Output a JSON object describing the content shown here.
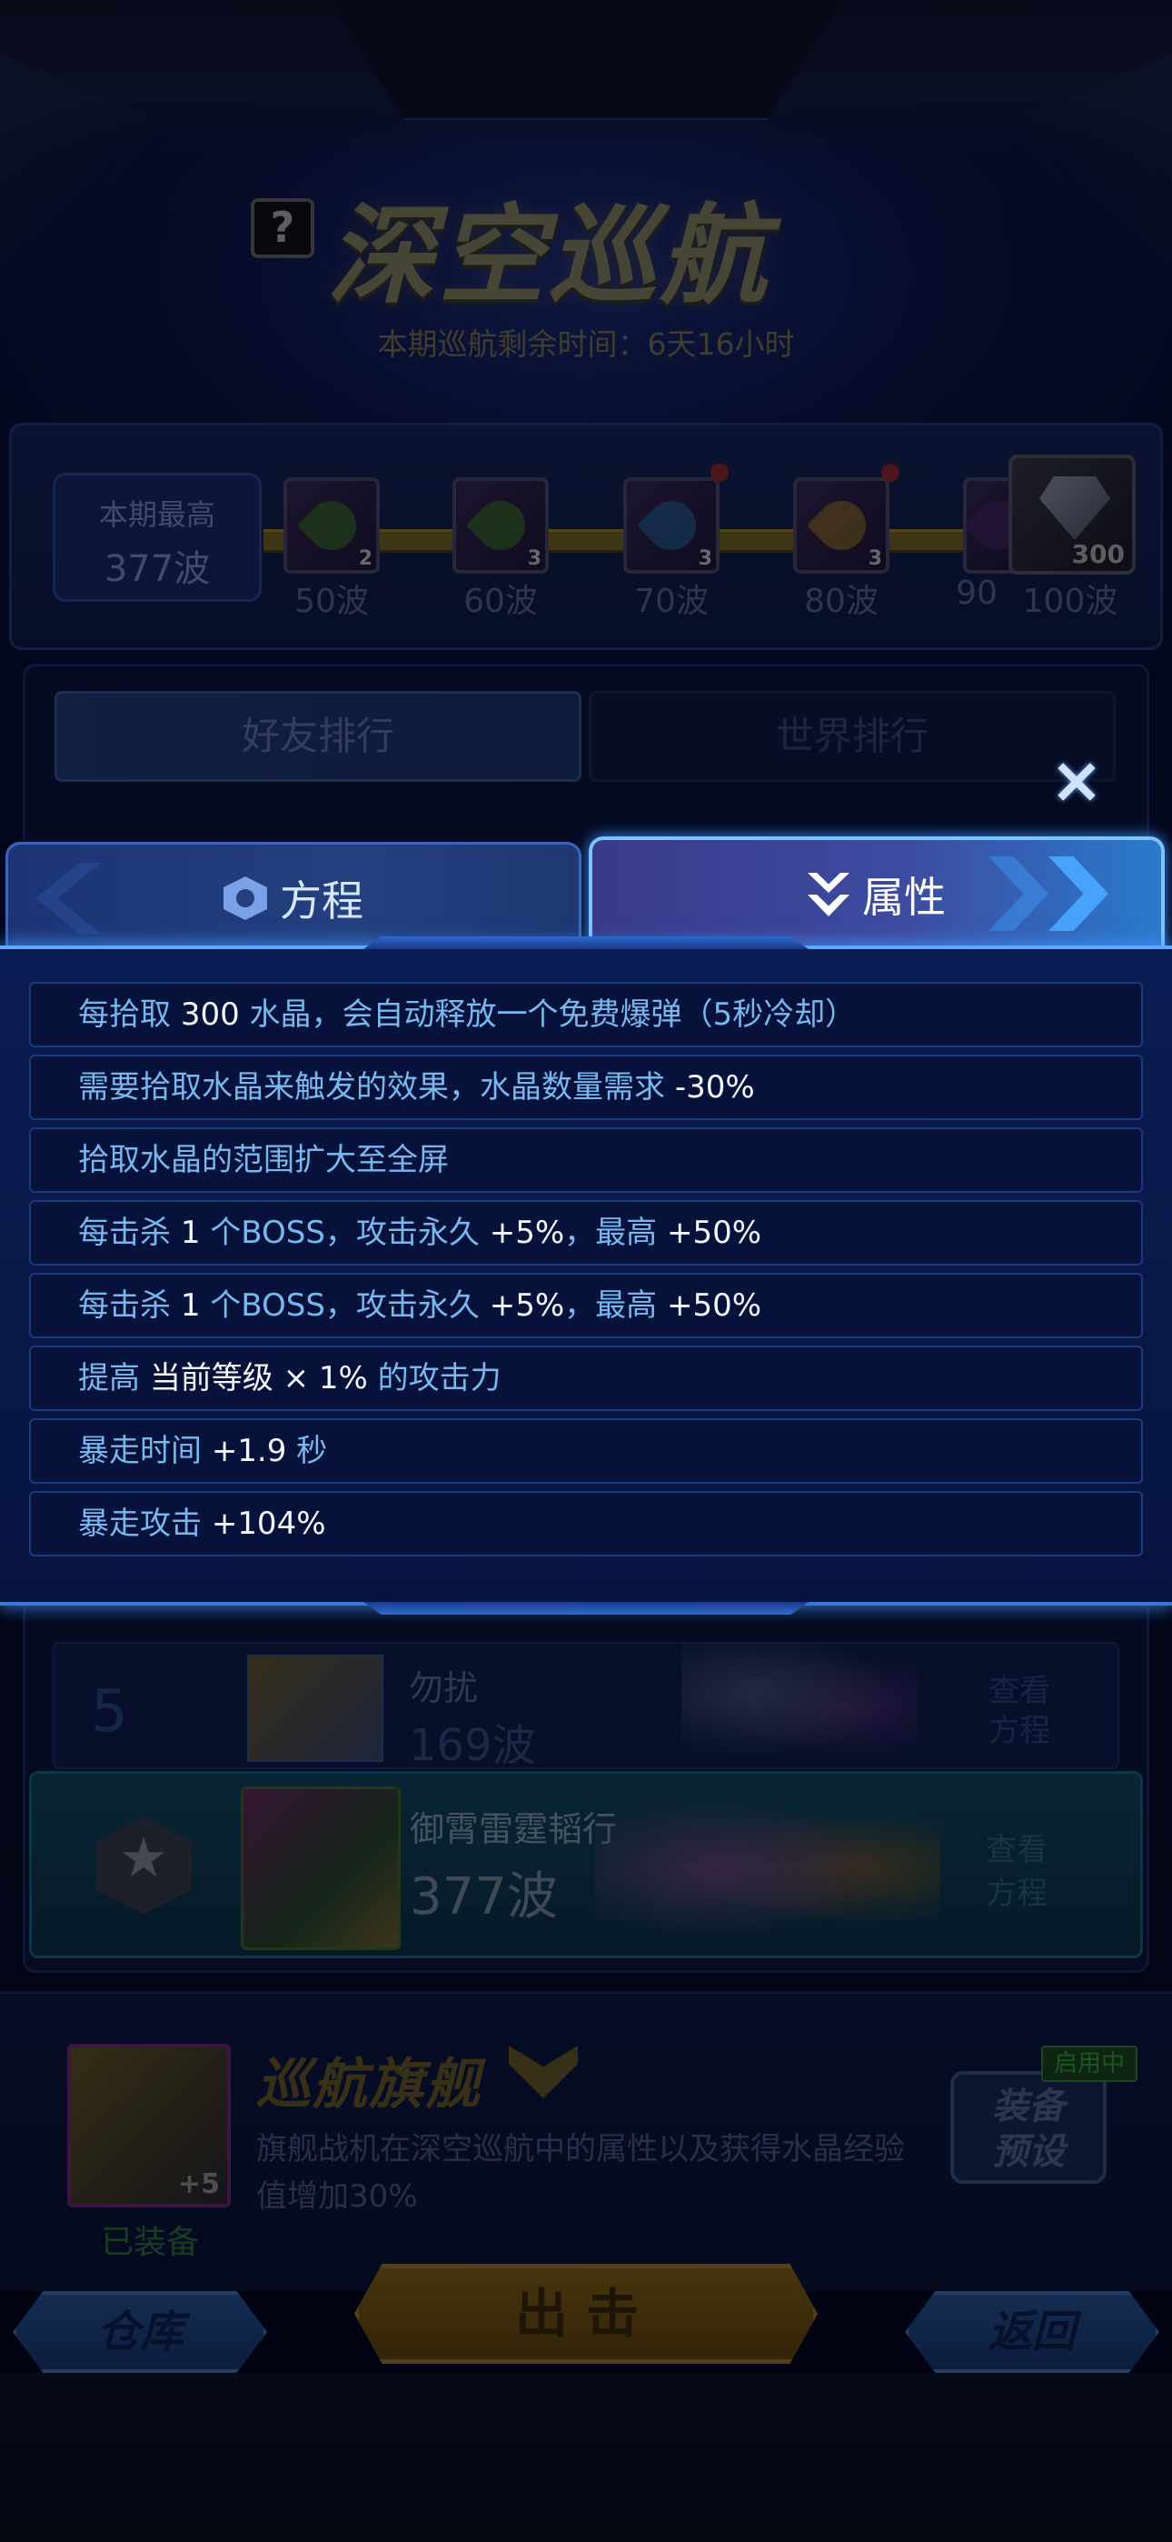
{
  "header": {
    "title": "深空巡航",
    "subtitle": "本期巡航剩余时间：6天16小时",
    "help_icon": "?"
  },
  "wave_progress": {
    "best_label": "本期最高",
    "best_value": "377波",
    "rewards": [
      {
        "label": "50波",
        "count": "2",
        "icon": "green-key-icon"
      },
      {
        "label": "60波",
        "count": "3",
        "icon": "green-key-icon"
      },
      {
        "label": "70波",
        "count": "3",
        "icon": "blue-key-icon"
      },
      {
        "label": "80波",
        "count": "3",
        "icon": "gold-key-icon"
      },
      {
        "label": "90",
        "count": "",
        "icon": "key-icon"
      },
      {
        "label": "100波",
        "count": "300",
        "icon": "diamond-icon"
      }
    ]
  },
  "leaderboard": {
    "tab_friends": "好友排行",
    "tab_world": "世界排行",
    "rows": [
      {
        "rank": "5",
        "name": "勿扰",
        "wave": "169波",
        "link": "查看方程"
      }
    ],
    "self": {
      "name": "御霄雷霆韬行",
      "wave": "377波",
      "link": "查看方程"
    }
  },
  "flagship": {
    "title": "巡航旗舰",
    "description": "旗舰战机在深空巡航中的属性以及获得水晶经验值增加30%",
    "equipped": "已装备",
    "level": "+5",
    "preset_label_1": "装备",
    "preset_label_2": "预设",
    "in_use": "启用中"
  },
  "buttons": {
    "warehouse": "仓库",
    "attack": "出击",
    "back": "返回"
  },
  "popup": {
    "close": "×",
    "tab_equation": "方程",
    "tab_attributes": "属性",
    "attributes": [
      [
        {
          "t": "每拾取 ",
          "w": false
        },
        {
          "t": "300",
          "w": true
        },
        {
          "t": " 水晶，会自动释放一个免费爆弹（5秒冷却）",
          "w": false
        }
      ],
      [
        {
          "t": "需要拾取水晶来触发的效果，水晶数量需求 ",
          "w": false
        },
        {
          "t": "-30%",
          "w": true
        }
      ],
      [
        {
          "t": "拾取水晶的范围扩大至全屏",
          "w": false
        }
      ],
      [
        {
          "t": "每击杀 ",
          "w": false
        },
        {
          "t": "1",
          "w": true
        },
        {
          "t": " 个BOSS，攻击永久 ",
          "w": false
        },
        {
          "t": "+5%",
          "w": true
        },
        {
          "t": "，最高 ",
          "w": false
        },
        {
          "t": "+50%",
          "w": true
        }
      ],
      [
        {
          "t": "每击杀 ",
          "w": false
        },
        {
          "t": "1",
          "w": true
        },
        {
          "t": " 个BOSS，攻击永久 ",
          "w": false
        },
        {
          "t": "+5%",
          "w": true
        },
        {
          "t": "，最高 ",
          "w": false
        },
        {
          "t": "+50%",
          "w": true
        }
      ],
      [
        {
          "t": "提高 ",
          "w": false
        },
        {
          "t": "当前等级 × 1%",
          "w": true
        },
        {
          "t": " 的攻击力",
          "w": false
        }
      ],
      [
        {
          "t": "暴走时间 ",
          "w": false
        },
        {
          "t": "+1.9",
          "w": true
        },
        {
          "t": " 秒",
          "w": false
        }
      ],
      [
        {
          "t": "暴走攻击 ",
          "w": false
        },
        {
          "t": "+104%",
          "w": true
        }
      ]
    ]
  },
  "colors": {
    "accent_blue": "#5aa8ff",
    "highlight_text": "#f4f7ff",
    "attr_text": "#78b8f0"
  }
}
